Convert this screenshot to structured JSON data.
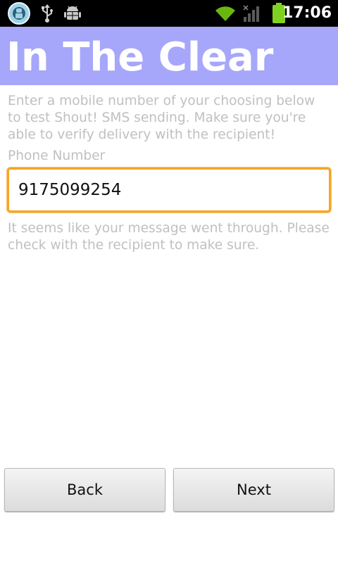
{
  "status_bar": {
    "time": "17:06",
    "left_icons": [
      "cyanogen-icon",
      "usb-icon",
      "android-debug-icon"
    ],
    "right_icons": [
      "wifi-icon",
      "signal-icon",
      "battery-icon"
    ]
  },
  "header": {
    "title": "In The Clear",
    "background_color": "#a6a6fb"
  },
  "main": {
    "instructions": "Enter a mobile number of your choosing below to test Shout! SMS sending. Make sure you're able to verify delivery with the recipient!",
    "phone_label": "Phone Number",
    "phone_value": "9175099254",
    "result_message": "It seems like your message went through. Please check with the recipient to make sure."
  },
  "buttons": {
    "back_label": "Back",
    "next_label": "Next"
  },
  "colors": {
    "accent": "#f5a623",
    "muted_text": "#c0c0c0"
  }
}
